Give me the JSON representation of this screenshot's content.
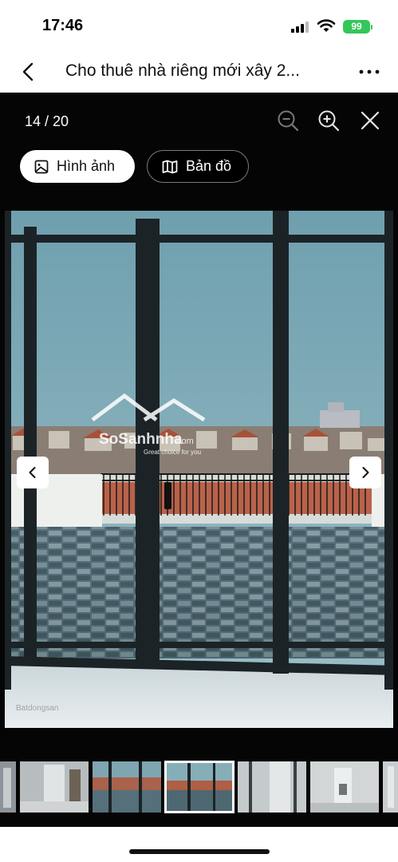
{
  "status": {
    "time": "17:46",
    "battery": "99"
  },
  "header": {
    "title": "Cho thuê nhà riêng mới xây 2..."
  },
  "viewer": {
    "counter": "14 / 20",
    "current_index": 14,
    "total": 20,
    "tabs": [
      {
        "label": "Hình ảnh",
        "icon": "image-icon",
        "active": true
      },
      {
        "label": "Bản đồ",
        "icon": "map-icon",
        "active": false
      }
    ],
    "tools": [
      "zoom-out-icon",
      "zoom-in-icon",
      "close-icon"
    ],
    "photo": {
      "watermark_brand": "SoSanhnha.com",
      "watermark_tagline": "Great choice for you",
      "corner_brand": "Batdongsan"
    },
    "thumbnails_visible": 7,
    "active_thumbnail": 3
  },
  "colors": {
    "accent": "#ffffff",
    "background": "#050505",
    "battery": "#34c759"
  }
}
